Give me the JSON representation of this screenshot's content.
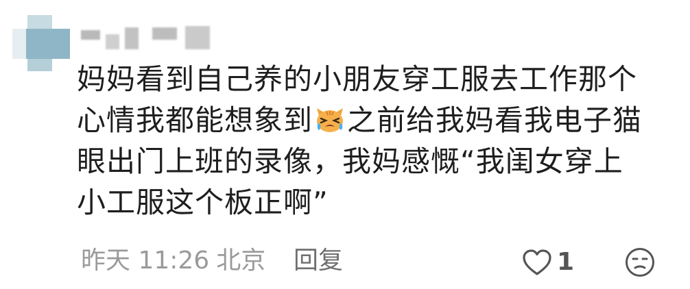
{
  "comment": {
    "lines": [
      "妈妈看到自己养的小朋友穿工服去工作那个",
      "心情我都能想象到",
      "之前给我妈看我电子猫",
      "眼出门上班的录像，我妈感慨“我闺女穿上",
      "小工服这个板正啊”"
    ],
    "emoji": "crying-cat-emoji",
    "time": "昨天 11:26",
    "location": "北京",
    "reply_label": "回复",
    "like_count": "1"
  },
  "colors": {
    "text": "#1e1e1e",
    "meta": "#9a9a9a",
    "icon": "#555555",
    "avatar_accent": "#8fb6c6"
  }
}
